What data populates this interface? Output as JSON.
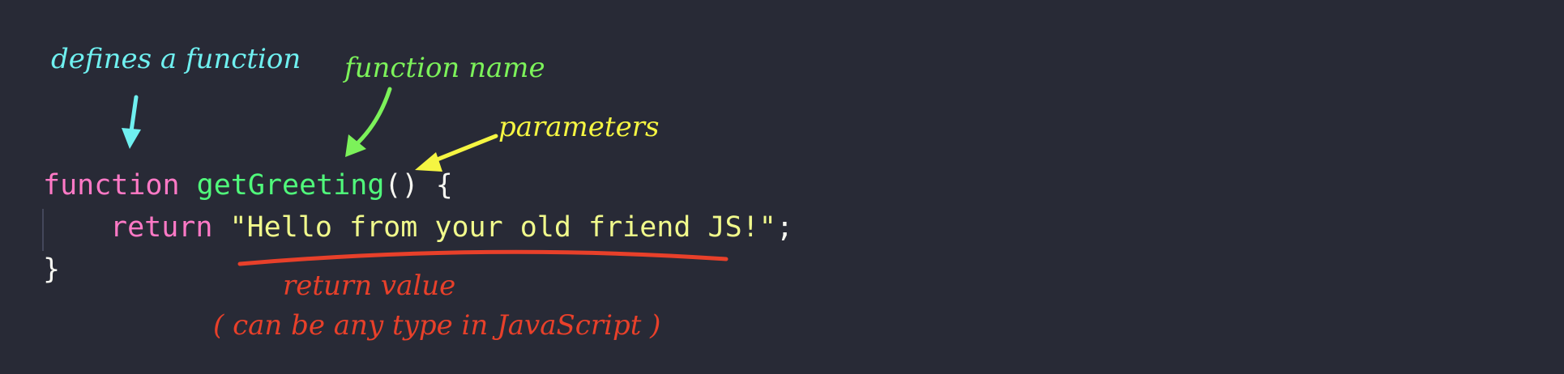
{
  "annotations": {
    "defines": {
      "text": "defines a function",
      "color": "#6ff0f0"
    },
    "fn_name": {
      "text": "function name",
      "color": "#7cf25a"
    },
    "params": {
      "text": "parameters",
      "color": "#f5f542"
    },
    "return_value": {
      "text": "return value",
      "color": "#e8402a"
    },
    "return_note": {
      "text": "( can be any type in JavaScript )",
      "color": "#e8402a"
    }
  },
  "code": {
    "line1": {
      "keyword": "function",
      "name": "getGreeting",
      "parens": "()",
      "brace": "{"
    },
    "line2": {
      "keyword": "return",
      "string": "\"Hello from your old friend JS!\"",
      "semicolon": ";"
    },
    "line3": {
      "brace": "}"
    }
  },
  "colors": {
    "background": "#282a36",
    "keyword": "#ff79c6",
    "function_name": "#50fa7b",
    "punctuation": "#f8f8f2",
    "string": "#f1fa8c"
  }
}
